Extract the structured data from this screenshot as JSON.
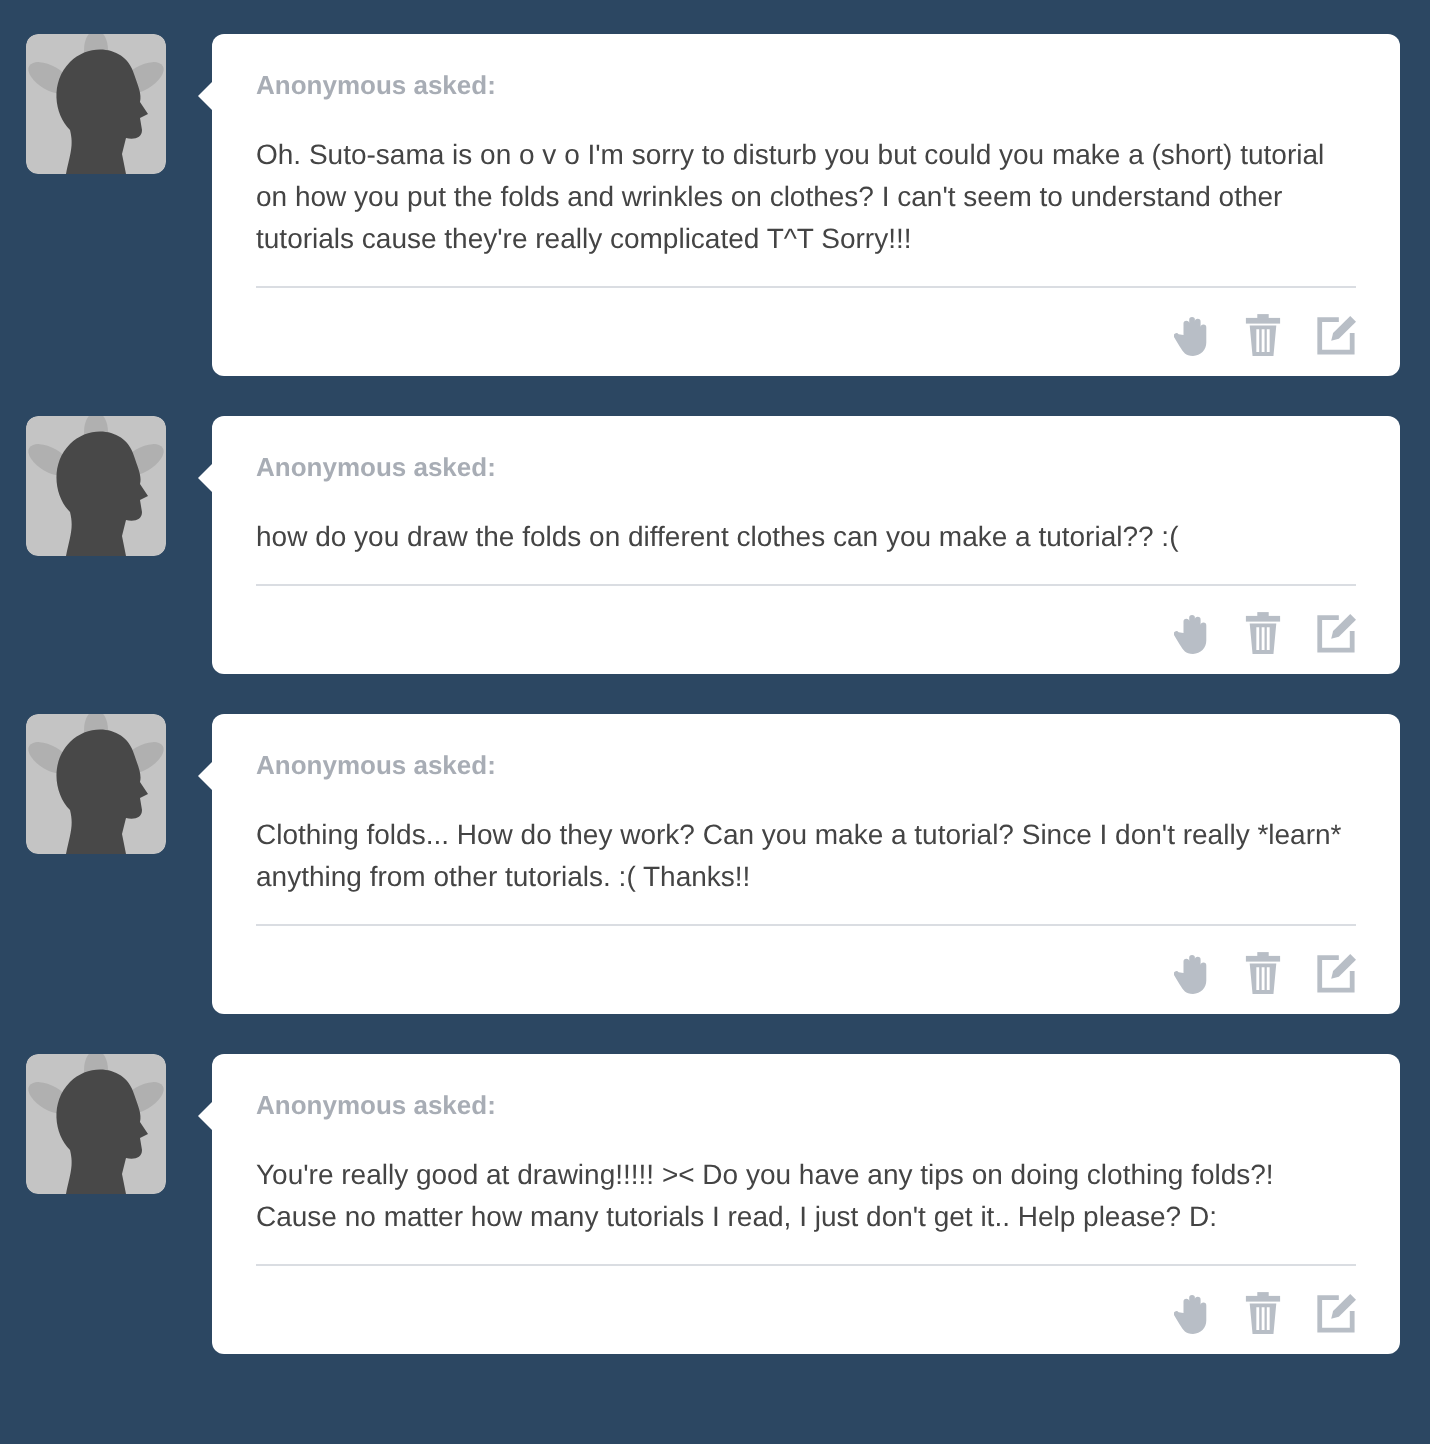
{
  "posts": [
    {
      "asker": "Anonymous asked:",
      "question": "Oh. Suto-sama is on o v o I'm sorry to disturb you but could you make a (short) tutorial on how you put the folds and wrinkles on clothes? I can't seem to understand other tutorials cause they're really complicated T^T Sorry!!!"
    },
    {
      "asker": "Anonymous asked:",
      "question": "how do you draw the folds on different clothes can you make a tutorial?? :("
    },
    {
      "asker": "Anonymous asked:",
      "question": "Clothing folds... How do they work? Can you make a tutorial? Since I don't really *learn* anything from other tutorials. :( Thanks!!"
    },
    {
      "asker": "Anonymous asked:",
      "question": "You're really good at drawing!!!!! >< Do you have any tips on doing clothing folds?! Cause no matter how many tutorials I read, I just don't get it.. Help please? D:"
    }
  ]
}
